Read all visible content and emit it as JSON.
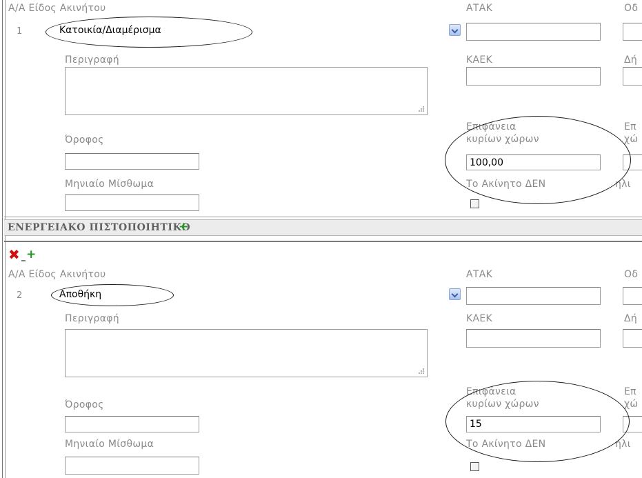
{
  "labels": {
    "aa_eidos": "Α/Α Είδος Ακινήτου",
    "atak": "ΑΤΑΚ",
    "od_partial": "Οδ",
    "perigrafi": "Περιγραφή",
    "kaek": "ΚΑΕΚ",
    "di_partial": "Δή",
    "epifaneia_line1": "Επιφάνεια",
    "epifaneia_line2": "κυρίων χώρων",
    "ep_partial_line1": "Επ",
    "ep_partial_line2": "χώ",
    "orofos": "Όροφος",
    "misthoma": "Μηνιαίο Μίσθωμα",
    "akinito_den": "Το Ακίνητο ΔΕΝ",
    "akinito_den_partial": "ηλι"
  },
  "energy_section": {
    "title": "ΕΝΕΡΓΕΙΑΚΟ ΠΙΣΤΟΠΟΙΗΤΙΚΟ"
  },
  "properties": [
    {
      "index": "1",
      "type": "Κατοικία/Διαμέρισμα",
      "atak": "",
      "kaek": "",
      "perigrafi": "",
      "orofos": "",
      "misthoma": "",
      "epifaneia": "100,00",
      "den_checked": false
    },
    {
      "index": "2",
      "type": "Αποθήκη",
      "atak": "",
      "kaek": "",
      "perigrafi": "",
      "orofos": "",
      "misthoma": "",
      "epifaneia": "15",
      "den_checked": false
    }
  ],
  "icons": {
    "add": "plus-icon",
    "delete": "delete-x-icon"
  },
  "colors": {
    "label_gray": "#8a8a8a",
    "add_green": "#1e9a1e",
    "delete_red": "#d01010",
    "select_blue": "#a9c3ef",
    "section_bar": "#ececec"
  }
}
